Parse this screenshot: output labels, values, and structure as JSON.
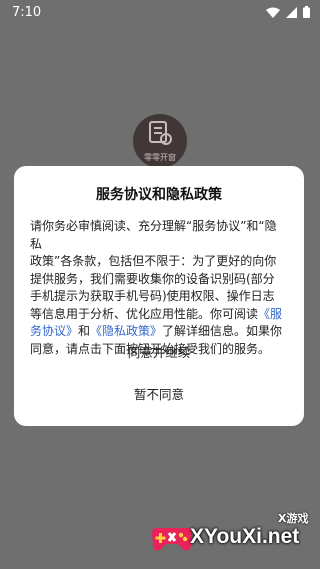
{
  "status_bar": {
    "time": "7:10"
  },
  "app_logo": {
    "label": "零零开窗"
  },
  "dialog": {
    "title": "服务协议和隐私政策",
    "body_line1": "请你务必审慎阅读、充分理解“服务协议”和“隐私",
    "body_line2": "政策”各条款，包括但不限于：为了更好的向你",
    "body_line3": "提供服务，我们需要收集你的设备识别码(部分",
    "body_line4": "手机提示为获取手机号码)使用权限、操作日志",
    "body_line5_pre": "等信息用于分析、优化应用性能。你可阅读",
    "body_link_service_a": "《服",
    "body_link_service_b": "务协议》",
    "body_and": "和",
    "body_link_privacy": "《隐私政策》",
    "body_line6_post": "了解详细信息。如果你",
    "body_line7": "同意，请点击下面按钮开始接受我们的服务。",
    "agree_label": "同意并继续",
    "decline_label": "暂不同意"
  },
  "watermark": {
    "tag": "X游戏",
    "site": "XYouXi.net"
  },
  "colors": {
    "overlay": "#6f6f6f",
    "link": "#3366cc",
    "dialog_bg": "#ffffff"
  }
}
